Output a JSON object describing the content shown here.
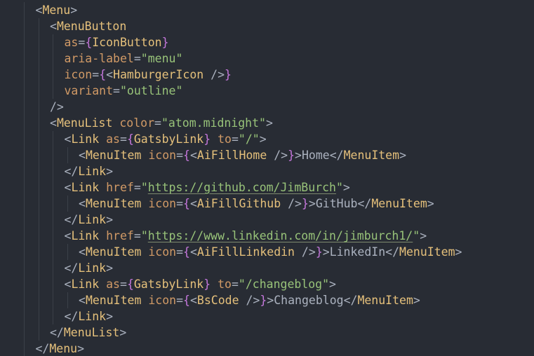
{
  "editor": {
    "language": "jsx",
    "colors": {
      "background": "#282c34",
      "punctuation": "#abb2bf",
      "component": "#e5c07b",
      "attribute": "#d19a66",
      "brace": "#c678dd",
      "string": "#98c379",
      "text": "#abb2bf",
      "indent_guide": "#3b4048"
    },
    "lines": [
      {
        "indent": 1,
        "tokens": [
          {
            "t": "punct",
            "v": "<"
          },
          {
            "t": "tag",
            "v": "Menu"
          },
          {
            "t": "punct",
            "v": ">"
          }
        ]
      },
      {
        "indent": 2,
        "tokens": [
          {
            "t": "punct",
            "v": "<"
          },
          {
            "t": "tag",
            "v": "MenuButton"
          }
        ]
      },
      {
        "indent": 3,
        "tokens": [
          {
            "t": "attr",
            "v": "as"
          },
          {
            "t": "punct",
            "v": "="
          },
          {
            "t": "brace",
            "v": "{"
          },
          {
            "t": "tag",
            "v": "IconButton"
          },
          {
            "t": "brace",
            "v": "}"
          }
        ]
      },
      {
        "indent": 3,
        "tokens": [
          {
            "t": "attr",
            "v": "aria-label"
          },
          {
            "t": "punct",
            "v": "="
          },
          {
            "t": "str",
            "v": "\"menu\""
          }
        ]
      },
      {
        "indent": 3,
        "tokens": [
          {
            "t": "attr",
            "v": "icon"
          },
          {
            "t": "punct",
            "v": "="
          },
          {
            "t": "brace",
            "v": "{"
          },
          {
            "t": "punct",
            "v": "<"
          },
          {
            "t": "tag",
            "v": "HamburgerIcon"
          },
          {
            "t": "punct",
            "v": " />"
          },
          {
            "t": "brace",
            "v": "}"
          }
        ]
      },
      {
        "indent": 3,
        "tokens": [
          {
            "t": "attr",
            "v": "variant"
          },
          {
            "t": "punct",
            "v": "="
          },
          {
            "t": "str",
            "v": "\"outline\""
          }
        ]
      },
      {
        "indent": 2,
        "tokens": [
          {
            "t": "punct",
            "v": "/>"
          }
        ]
      },
      {
        "indent": 2,
        "tokens": [
          {
            "t": "punct",
            "v": "<"
          },
          {
            "t": "tag",
            "v": "MenuList"
          },
          {
            "t": "punct",
            "v": " "
          },
          {
            "t": "attr",
            "v": "color"
          },
          {
            "t": "punct",
            "v": "="
          },
          {
            "t": "str",
            "v": "\"atom.midnight\""
          },
          {
            "t": "punct",
            "v": ">"
          }
        ]
      },
      {
        "indent": 3,
        "tokens": [
          {
            "t": "punct",
            "v": "<"
          },
          {
            "t": "tag",
            "v": "Link"
          },
          {
            "t": "punct",
            "v": " "
          },
          {
            "t": "attr",
            "v": "as"
          },
          {
            "t": "punct",
            "v": "="
          },
          {
            "t": "brace",
            "v": "{"
          },
          {
            "t": "tag",
            "v": "GatsbyLink"
          },
          {
            "t": "brace",
            "v": "}"
          },
          {
            "t": "punct",
            "v": " "
          },
          {
            "t": "attr",
            "v": "to"
          },
          {
            "t": "punct",
            "v": "="
          },
          {
            "t": "str",
            "v": "\"/\""
          },
          {
            "t": "punct",
            "v": ">"
          }
        ]
      },
      {
        "indent": 4,
        "tokens": [
          {
            "t": "punct",
            "v": "<"
          },
          {
            "t": "tag",
            "v": "MenuItem"
          },
          {
            "t": "punct",
            "v": " "
          },
          {
            "t": "attr",
            "v": "icon"
          },
          {
            "t": "punct",
            "v": "="
          },
          {
            "t": "brace",
            "v": "{"
          },
          {
            "t": "punct",
            "v": "<"
          },
          {
            "t": "tag",
            "v": "AiFillHome"
          },
          {
            "t": "punct",
            "v": " />"
          },
          {
            "t": "brace",
            "v": "}"
          },
          {
            "t": "punct",
            "v": ">"
          },
          {
            "t": "text",
            "v": "Home"
          },
          {
            "t": "punct",
            "v": "</"
          },
          {
            "t": "tag",
            "v": "MenuItem"
          },
          {
            "t": "punct",
            "v": ">"
          }
        ]
      },
      {
        "indent": 3,
        "tokens": [
          {
            "t": "punct",
            "v": "</"
          },
          {
            "t": "tag",
            "v": "Link"
          },
          {
            "t": "punct",
            "v": ">"
          }
        ]
      },
      {
        "indent": 3,
        "tokens": [
          {
            "t": "punct",
            "v": "<"
          },
          {
            "t": "tag",
            "v": "Link"
          },
          {
            "t": "punct",
            "v": " "
          },
          {
            "t": "attr",
            "v": "href"
          },
          {
            "t": "punct",
            "v": "="
          },
          {
            "t": "str",
            "v": "\""
          },
          {
            "t": "url",
            "v": "https://github.com/JimBurch"
          },
          {
            "t": "str",
            "v": "\""
          },
          {
            "t": "punct",
            "v": ">"
          }
        ]
      },
      {
        "indent": 4,
        "tokens": [
          {
            "t": "punct",
            "v": "<"
          },
          {
            "t": "tag",
            "v": "MenuItem"
          },
          {
            "t": "punct",
            "v": " "
          },
          {
            "t": "attr",
            "v": "icon"
          },
          {
            "t": "punct",
            "v": "="
          },
          {
            "t": "brace",
            "v": "{"
          },
          {
            "t": "punct",
            "v": "<"
          },
          {
            "t": "tag",
            "v": "AiFillGithub"
          },
          {
            "t": "punct",
            "v": " />"
          },
          {
            "t": "brace",
            "v": "}"
          },
          {
            "t": "punct",
            "v": ">"
          },
          {
            "t": "text",
            "v": "GitHub"
          },
          {
            "t": "punct",
            "v": "</"
          },
          {
            "t": "tag",
            "v": "MenuItem"
          },
          {
            "t": "punct",
            "v": ">"
          }
        ]
      },
      {
        "indent": 3,
        "tokens": [
          {
            "t": "punct",
            "v": "</"
          },
          {
            "t": "tag",
            "v": "Link"
          },
          {
            "t": "punct",
            "v": ">"
          }
        ]
      },
      {
        "indent": 3,
        "tokens": [
          {
            "t": "punct",
            "v": "<"
          },
          {
            "t": "tag",
            "v": "Link"
          },
          {
            "t": "punct",
            "v": " "
          },
          {
            "t": "attr",
            "v": "href"
          },
          {
            "t": "punct",
            "v": "="
          },
          {
            "t": "str",
            "v": "\""
          },
          {
            "t": "url",
            "v": "https://www.linkedin.com/in/jimburch1/"
          },
          {
            "t": "str",
            "v": "\""
          },
          {
            "t": "punct",
            "v": ">"
          }
        ]
      },
      {
        "indent": 4,
        "tokens": [
          {
            "t": "punct",
            "v": "<"
          },
          {
            "t": "tag",
            "v": "MenuItem"
          },
          {
            "t": "punct",
            "v": " "
          },
          {
            "t": "attr",
            "v": "icon"
          },
          {
            "t": "punct",
            "v": "="
          },
          {
            "t": "brace",
            "v": "{"
          },
          {
            "t": "punct",
            "v": "<"
          },
          {
            "t": "tag",
            "v": "AiFillLinkedin"
          },
          {
            "t": "punct",
            "v": " />"
          },
          {
            "t": "brace",
            "v": "}"
          },
          {
            "t": "punct",
            "v": ">"
          },
          {
            "t": "text",
            "v": "LinkedIn"
          },
          {
            "t": "punct",
            "v": "</"
          },
          {
            "t": "tag",
            "v": "MenuItem"
          },
          {
            "t": "punct",
            "v": ">"
          }
        ]
      },
      {
        "indent": 3,
        "tokens": [
          {
            "t": "punct",
            "v": "</"
          },
          {
            "t": "tag",
            "v": "Link"
          },
          {
            "t": "punct",
            "v": ">"
          }
        ]
      },
      {
        "indent": 3,
        "tokens": [
          {
            "t": "punct",
            "v": "<"
          },
          {
            "t": "tag",
            "v": "Link"
          },
          {
            "t": "punct",
            "v": " "
          },
          {
            "t": "attr",
            "v": "as"
          },
          {
            "t": "punct",
            "v": "="
          },
          {
            "t": "brace",
            "v": "{"
          },
          {
            "t": "tag",
            "v": "GatsbyLink"
          },
          {
            "t": "brace",
            "v": "}"
          },
          {
            "t": "punct",
            "v": " "
          },
          {
            "t": "attr",
            "v": "to"
          },
          {
            "t": "punct",
            "v": "="
          },
          {
            "t": "str",
            "v": "\"/changeblog\""
          },
          {
            "t": "punct",
            "v": ">"
          }
        ]
      },
      {
        "indent": 4,
        "tokens": [
          {
            "t": "punct",
            "v": "<"
          },
          {
            "t": "tag",
            "v": "MenuItem"
          },
          {
            "t": "punct",
            "v": " "
          },
          {
            "t": "attr",
            "v": "icon"
          },
          {
            "t": "punct",
            "v": "="
          },
          {
            "t": "brace",
            "v": "{"
          },
          {
            "t": "punct",
            "v": "<"
          },
          {
            "t": "tag",
            "v": "BsCode"
          },
          {
            "t": "punct",
            "v": " />"
          },
          {
            "t": "brace",
            "v": "}"
          },
          {
            "t": "punct",
            "v": ">"
          },
          {
            "t": "text",
            "v": "Changeblog"
          },
          {
            "t": "punct",
            "v": "</"
          },
          {
            "t": "tag",
            "v": "MenuItem"
          },
          {
            "t": "punct",
            "v": ">"
          }
        ]
      },
      {
        "indent": 3,
        "tokens": [
          {
            "t": "punct",
            "v": "</"
          },
          {
            "t": "tag",
            "v": "Link"
          },
          {
            "t": "punct",
            "v": ">"
          }
        ]
      },
      {
        "indent": 2,
        "tokens": [
          {
            "t": "punct",
            "v": "</"
          },
          {
            "t": "tag",
            "v": "MenuList"
          },
          {
            "t": "punct",
            "v": ">"
          }
        ]
      },
      {
        "indent": 1,
        "tokens": [
          {
            "t": "punct",
            "v": "</"
          },
          {
            "t": "tag",
            "v": "Menu"
          },
          {
            "t": "punct",
            "v": ">"
          }
        ]
      }
    ]
  }
}
